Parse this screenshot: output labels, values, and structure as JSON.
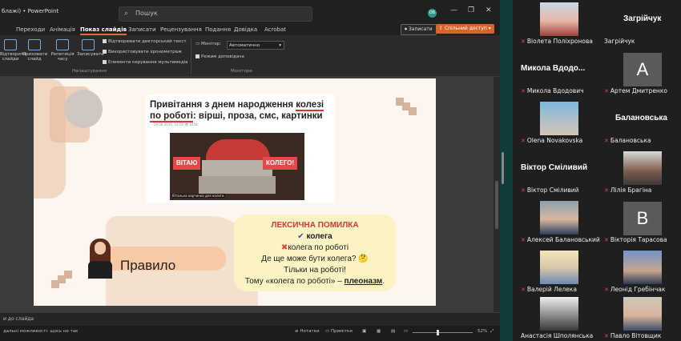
{
  "titlebar": {
    "title": "блажі)  •  PowerPoint",
    "search_placeholder": "Пошук",
    "user_initials": "ОБ",
    "minimize": "—",
    "restore": "❐",
    "close": "✕"
  },
  "menu": {
    "tabs": [
      "Переходи",
      "Анімація",
      "Показ слайдів",
      "Записати",
      "Рецензування",
      "Подання",
      "Довідка",
      "Acrobat"
    ],
    "active_index": 2,
    "record_button": "Записати",
    "share_button": "Спільний доступ"
  },
  "ribbon": {
    "buttons": [
      {
        "label": "Відтворити слайди"
      },
      {
        "label": "Приховати слайд"
      },
      {
        "label": "Репетиція часу"
      },
      {
        "label": "Записувати"
      }
    ],
    "checkboxes": [
      {
        "label": "Відтворювати дикторський текст"
      },
      {
        "label": "Використовувати хронометраж"
      },
      {
        "label": "Елементи керування мультимедіа"
      }
    ],
    "group_setup": "Налаштування",
    "monitor_label": "Монітор:",
    "monitor_value": "Автоматично",
    "presenter_view": "Режим доповідача",
    "group_monitors": "Монітори"
  },
  "slide": {
    "article_title_part1": "Привітання з днем народження ",
    "article_title_underlined": "колезі по роботі",
    "article_title_part2": ": вірші, проза, смс, картинки",
    "article_meta": "29.08.2019, 14:58      👁 6458",
    "sign_left": "ВІТАЮ",
    "sign_right": "КОЛЕГО!",
    "image_caption": "Вітальна картинка для колеги",
    "rule_title": "Правило",
    "box": {
      "heading": "ЛЕКСИЧНА ПОМИЛКА",
      "correct": "колега",
      "wrong": "колега по роботі",
      "q1": "Де ще може бути колега?",
      "q2": "Тільки на роботі!",
      "conclusion_part1": "Тому «колега по роботі» – ",
      "conclusion_term": "плеоназм",
      "conclusion_end": "."
    }
  },
  "notes_placeholder": "и до слайда",
  "status": {
    "accessibility": "дальні можливості: щось не так",
    "notes": "Нотатки",
    "comments": "Примітки",
    "zoom": "52%"
  },
  "participants": [
    {
      "name": "Віолета Поліхронова",
      "photo": "ph-a"
    },
    {
      "name": "Загрійчук",
      "display": "Загрійчук"
    },
    {
      "name": "Микола Вдодович",
      "display": "Микола Вдодо..."
    },
    {
      "name": "Артем Дмитренко",
      "letter": "A"
    },
    {
      "name": "Olena Novakovska",
      "photo": "ph-b"
    },
    {
      "name": "Балановська",
      "display": "Балановська"
    },
    {
      "name": "Віктор Сміливий",
      "display": "Віктор Сміливий"
    },
    {
      "name": "Лілія Брагіна",
      "photo": "ph-c"
    },
    {
      "name": "Алексей Балановський",
      "photo": "ph-d"
    },
    {
      "name": "Вікторія Тарасова",
      "letter": "B"
    },
    {
      "name": "Валерій Лелека",
      "photo": "ph-f"
    },
    {
      "name": "Леонід Гребінчак",
      "photo": "ph-g"
    },
    {
      "name": "Анастасія Шполянська",
      "photo": "ph-h"
    },
    {
      "name": "Павло Вітовщик",
      "photo": "ph-i"
    }
  ]
}
